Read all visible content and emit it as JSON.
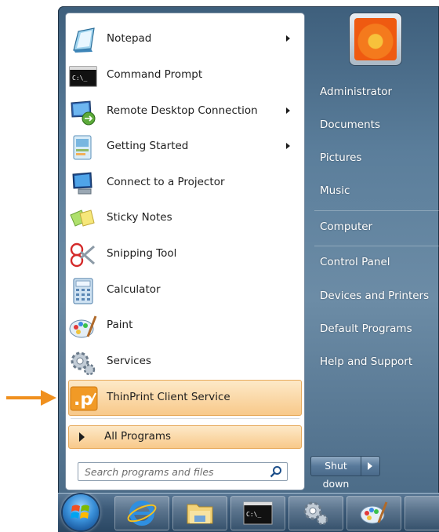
{
  "start_menu": {
    "programs": [
      {
        "label": "Notepad",
        "icon": "notepad-icon",
        "has_submenu": true
      },
      {
        "label": "Command Prompt",
        "icon": "command-prompt-icon",
        "has_submenu": false
      },
      {
        "label": "Remote Desktop Connection",
        "icon": "remote-desktop-icon",
        "has_submenu": true
      },
      {
        "label": "Getting Started",
        "icon": "getting-started-icon",
        "has_submenu": true
      },
      {
        "label": "Connect to a Projector",
        "icon": "projector-icon",
        "has_submenu": false
      },
      {
        "label": "Sticky Notes",
        "icon": "sticky-notes-icon",
        "has_submenu": false
      },
      {
        "label": "Snipping Tool",
        "icon": "snipping-tool-icon",
        "has_submenu": false
      },
      {
        "label": "Calculator",
        "icon": "calculator-icon",
        "has_submenu": false
      },
      {
        "label": "Paint",
        "icon": "paint-icon",
        "has_submenu": false
      },
      {
        "label": "Services",
        "icon": "services-icon",
        "has_submenu": false
      },
      {
        "label": "ThinPrint Client Service",
        "icon": "thinprint-icon",
        "has_submenu": false,
        "highlighted": true
      }
    ],
    "all_programs_label": "All Programs",
    "search_placeholder": "Search programs and files",
    "right_pane": {
      "items": [
        "Administrator",
        "Documents",
        "Pictures",
        "Music",
        "Computer",
        "Control Panel",
        "Devices and Printers",
        "Default Programs",
        "Help and Support"
      ]
    },
    "shutdown_label": "Shut down"
  },
  "taskbar": {
    "buttons": [
      "start-orb",
      "internet-explorer-icon",
      "windows-explorer-icon",
      "command-prompt-icon",
      "services-icon",
      "paint-icon"
    ]
  },
  "colors": {
    "highlight": "#f8c98a",
    "arrow": "#f0901e",
    "menu_blue": "#5b7e9b"
  }
}
